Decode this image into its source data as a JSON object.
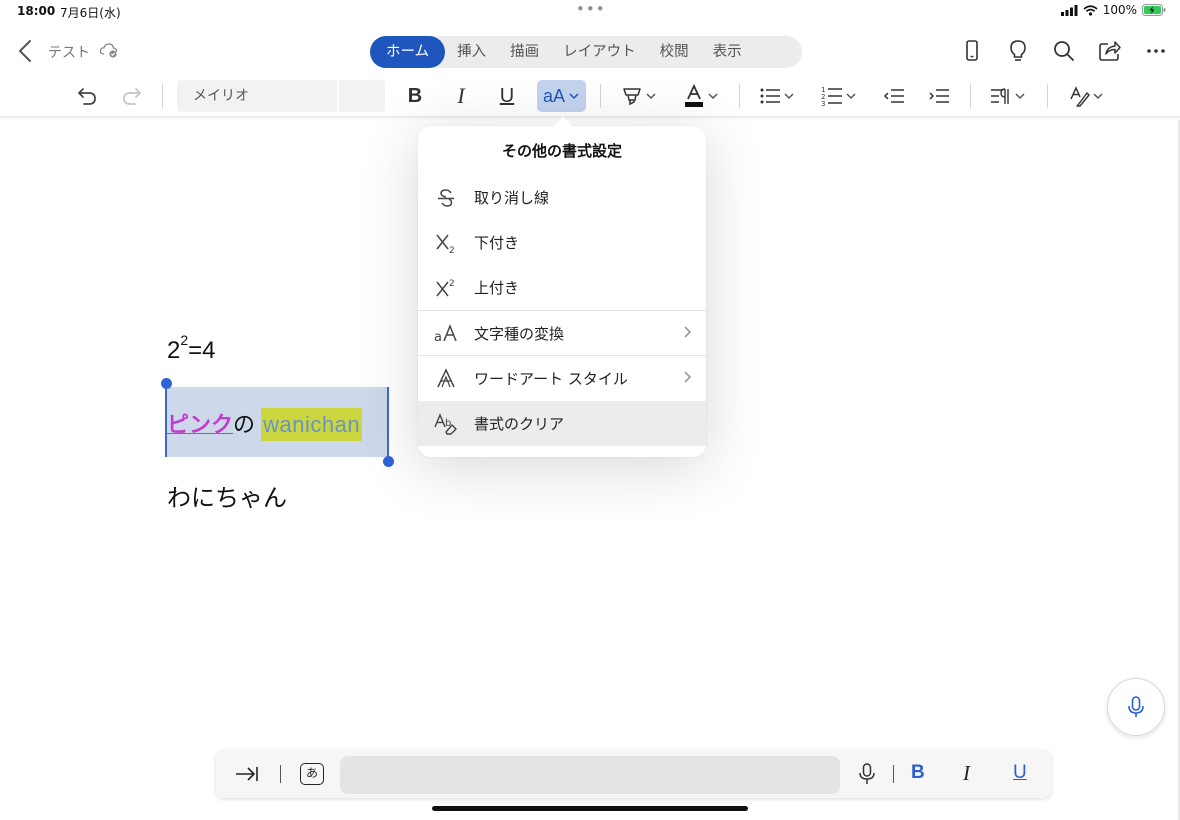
{
  "status_bar": {
    "time": "18:00",
    "date": "7月6日(水)",
    "battery": "100%"
  },
  "header": {
    "doc_title": "テスト",
    "tabs": [
      "ホーム",
      "挿入",
      "描画",
      "レイアウト",
      "校閲",
      "表示"
    ],
    "active_tab": "ホーム"
  },
  "ribbon": {
    "font_name": "メイリオ",
    "font_size": "",
    "text_effects_label": "aA"
  },
  "popover": {
    "title": "その他の書式設定",
    "items": [
      {
        "label": "取り消し線",
        "icon": "strikethrough-icon"
      },
      {
        "label": "下付き",
        "icon": "subscript-icon"
      },
      {
        "label": "上付き",
        "icon": "superscript-icon"
      },
      {
        "label": "文字種の変換",
        "icon": "change-case-icon"
      },
      {
        "label": "ワードアート スタイル",
        "icon": "wordart-icon"
      },
      {
        "label": "書式のクリア",
        "icon": "clear-format-icon"
      }
    ]
  },
  "document": {
    "line1_base": "2",
    "line1_sup": "2",
    "line1_rest": "=4",
    "line2_pink": "ピンク",
    "line2_no": "の",
    "line2_wani": "wanichan",
    "line3": "わにちゃん"
  },
  "input_bar": {
    "field_value": "",
    "ime_key": "あ",
    "bold": "B",
    "italic": "I",
    "underline": "U"
  },
  "colors": {
    "accent": "#1f56bd",
    "pink_text": "#c33ccd",
    "highlight": "#cbd63f",
    "selection": "#cdd9ea"
  }
}
